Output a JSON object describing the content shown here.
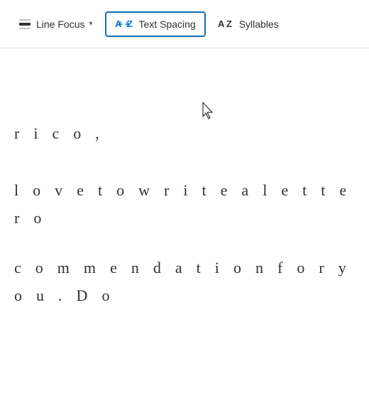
{
  "toolbar": {
    "line_focus": {
      "label": "Line Focus",
      "has_dropdown": true
    },
    "text_spacing": {
      "label": "Text Spacing",
      "active": true
    },
    "syllables": {
      "label": "Syllables"
    }
  },
  "content": {
    "line1": "r i c o ,",
    "line2": "l o v e  t o  w r i t e  a  l e t t e r  o",
    "line3": "c o m m e n d a t i o n  f o r  y o u .  D o"
  },
  "colors": {
    "accent": "#0078d4",
    "border_active": "#106ebe",
    "text": "#323130",
    "toolbar_bg": "#ffffff",
    "content_bg": "#ffffff"
  }
}
